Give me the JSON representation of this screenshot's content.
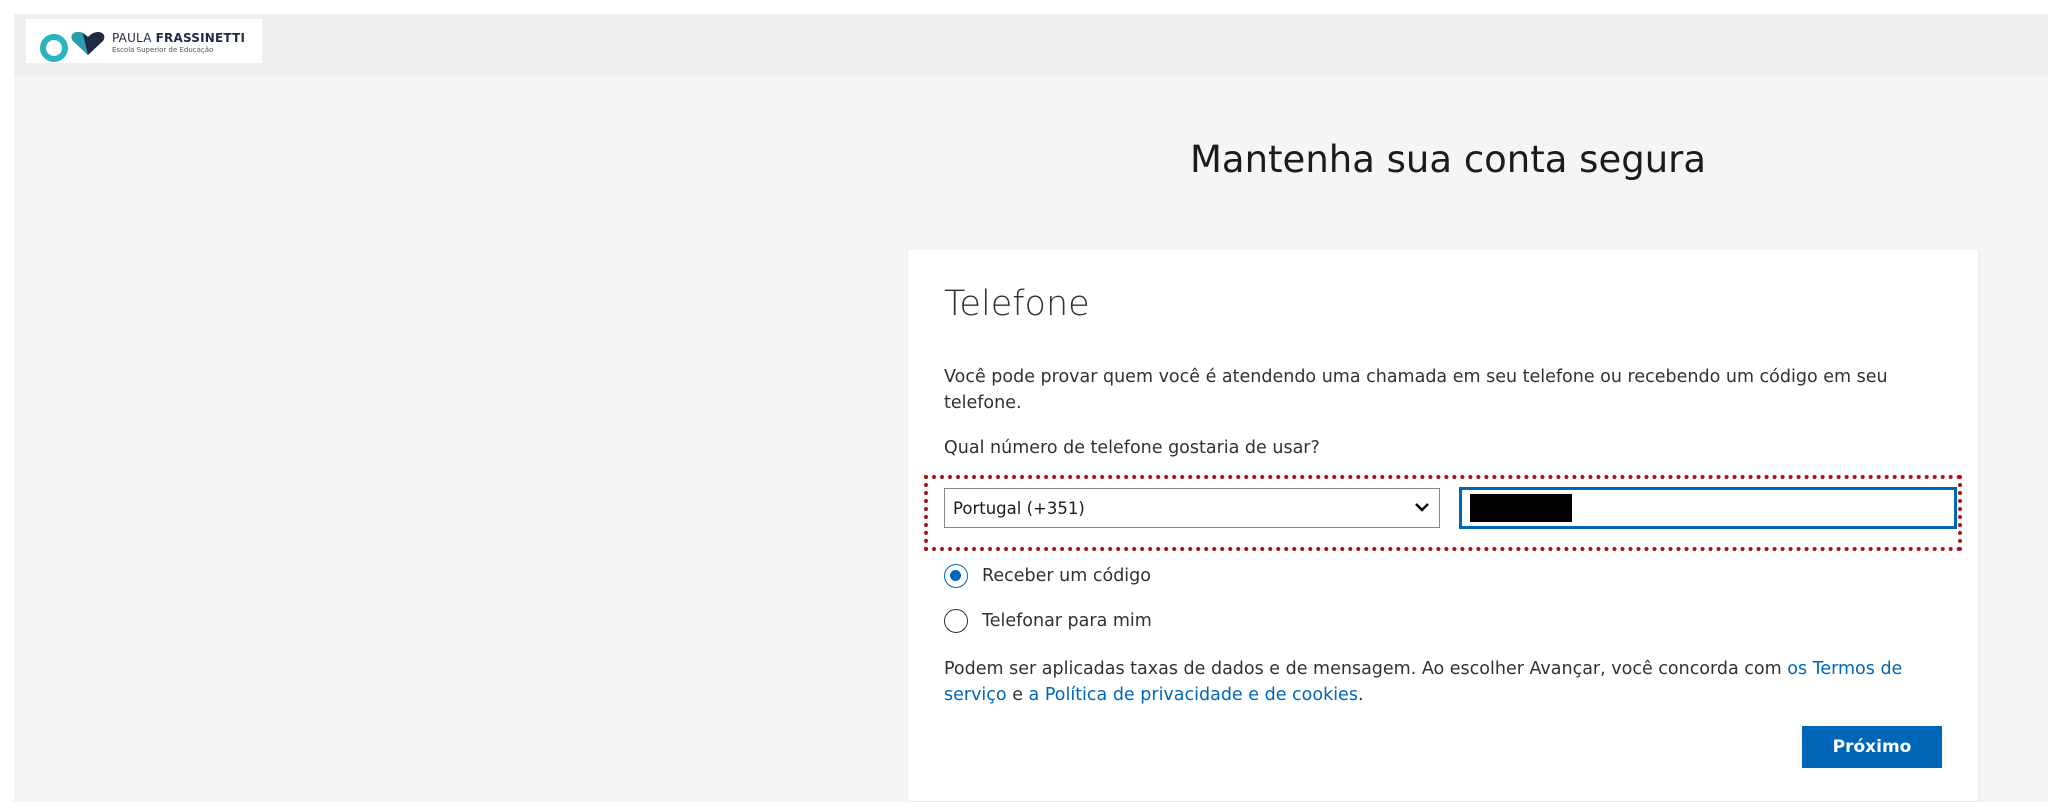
{
  "brand": {
    "name_light": "PAULA",
    "name_bold": "FRASSINETTI",
    "tagline": "Escola Superior de Educação",
    "circle_color": "#2bb3c0",
    "heart_color": "#1f2a44"
  },
  "page": {
    "title": "Mantenha sua conta segura"
  },
  "card": {
    "heading": "Telefone",
    "description": "Você pode provar quem você é atendendo uma chamada em seu telefone ou recebendo um código em seu telefone.",
    "question": "Qual número de telefone gostaria de usar?",
    "country_select": {
      "value": "Portugal (+351)"
    },
    "phone_input": {
      "value_redacted": true
    },
    "options": [
      {
        "label": "Receber um código",
        "selected": true
      },
      {
        "label": "Telefonar para mim",
        "selected": false
      }
    ],
    "fine_print": {
      "text_before": "Podem ser aplicadas taxas de dados e de mensagem. Ao escolher Avançar, você concorda com ",
      "terms_link": "os Termos de serviço",
      "text_middle": " e ",
      "privacy_link": "a Política de privacidade e de cookies",
      "text_after": "."
    },
    "next_button": "Próximo"
  },
  "colors": {
    "accent": "#0067b8",
    "annotation": "#b01018"
  }
}
